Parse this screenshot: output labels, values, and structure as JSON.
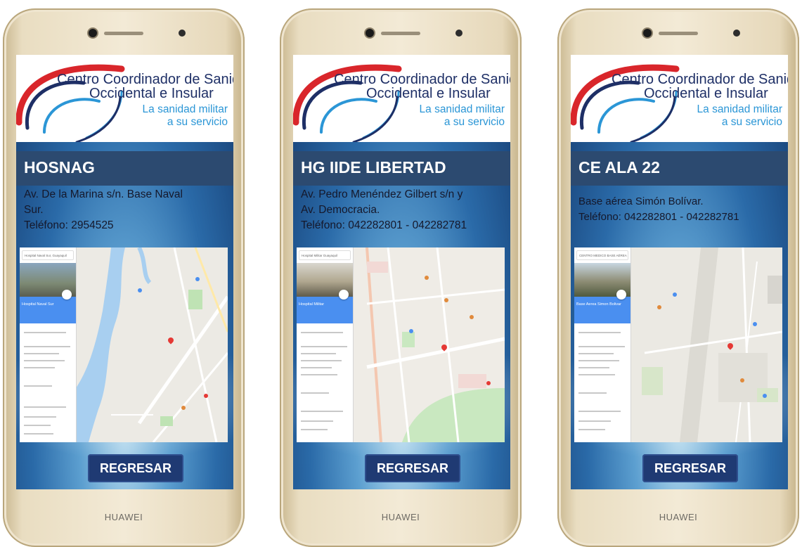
{
  "brand": "HUAWEI",
  "logo": {
    "line1": "Centro Coordinador de Sanidad",
    "line2": "Occidental e Insular",
    "line3": "La sanidad militar",
    "line4": "a su servicio",
    "colors": {
      "navy": "#1e2f66",
      "blue": "#2b96d6",
      "red": "#d9262b"
    }
  },
  "screens": [
    {
      "title": "HOSNAG",
      "address": [
        "Av. De la Marina s/n. Base Naval",
        "Sur.",
        "Teléfono: 2954525"
      ],
      "map": {
        "place": "Hospital Naval Sur, Guayaquil",
        "panel_title": "Hospital Naval Sur"
      },
      "button": "REGRESAR"
    },
    {
      "title": "HG IIDE LIBERTAD",
      "address": [
        "Av. Pedro Menéndez Gilbert s/n y",
        "Av. Democracia.",
        "Teléfono: 042282801 - 042282781"
      ],
      "map": {
        "place": "Hospital Militar Guayaquil",
        "panel_title": "Hospital Militar"
      },
      "button": "REGRESAR"
    },
    {
      "title": "CE ALA 22",
      "address": [
        "Base aérea Simón Bolívar.",
        "Teléfono: 042282801 - 042282781"
      ],
      "map": {
        "place": "CENTRO MEDICO BASE AÉREA",
        "panel_title": "Base Aerea Simon Bolivar"
      },
      "button": "REGRESAR"
    }
  ]
}
